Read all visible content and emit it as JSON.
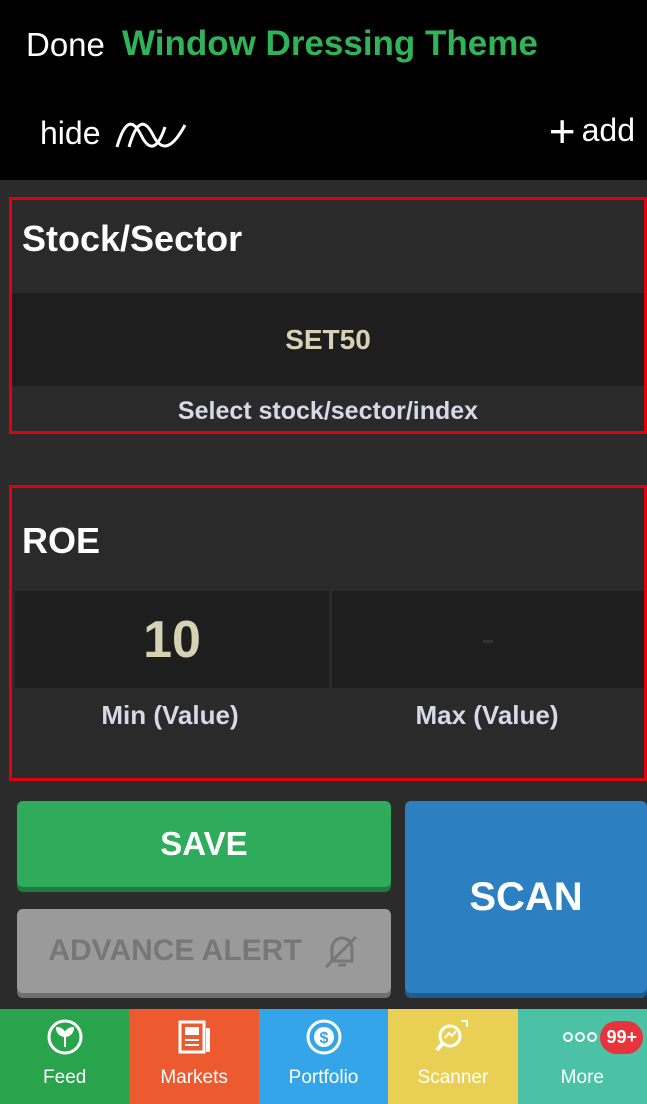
{
  "header": {
    "done_label": "Done",
    "title": "Window Dressing Theme",
    "hide_label": "hide",
    "add_label": "add"
  },
  "stock_section": {
    "title": "Stock/Sector",
    "value": "SET50",
    "caption": "Select stock/sector/index"
  },
  "roe_section": {
    "title": "ROE",
    "min_value": "10",
    "max_value": "-",
    "min_caption": "Min (Value)",
    "max_caption": "Max (Value)"
  },
  "buttons": {
    "save_label": "SAVE",
    "scan_label": "SCAN",
    "advance_alert_label": "ADVANCE ALERT"
  },
  "tabs": [
    {
      "label": "Feed",
      "color": "#2aa44c",
      "icon": "feed-icon"
    },
    {
      "label": "Markets",
      "color": "#ee5a2f",
      "icon": "markets-icon"
    },
    {
      "label": "Portfolio",
      "color": "#35a5e9",
      "icon": "portfolio-icon"
    },
    {
      "label": "Scanner",
      "color": "#e9cf54",
      "icon": "scanner-icon"
    },
    {
      "label": "More",
      "color": "#4bc1a6",
      "icon": "more-icon",
      "badge": "99+"
    }
  ]
}
